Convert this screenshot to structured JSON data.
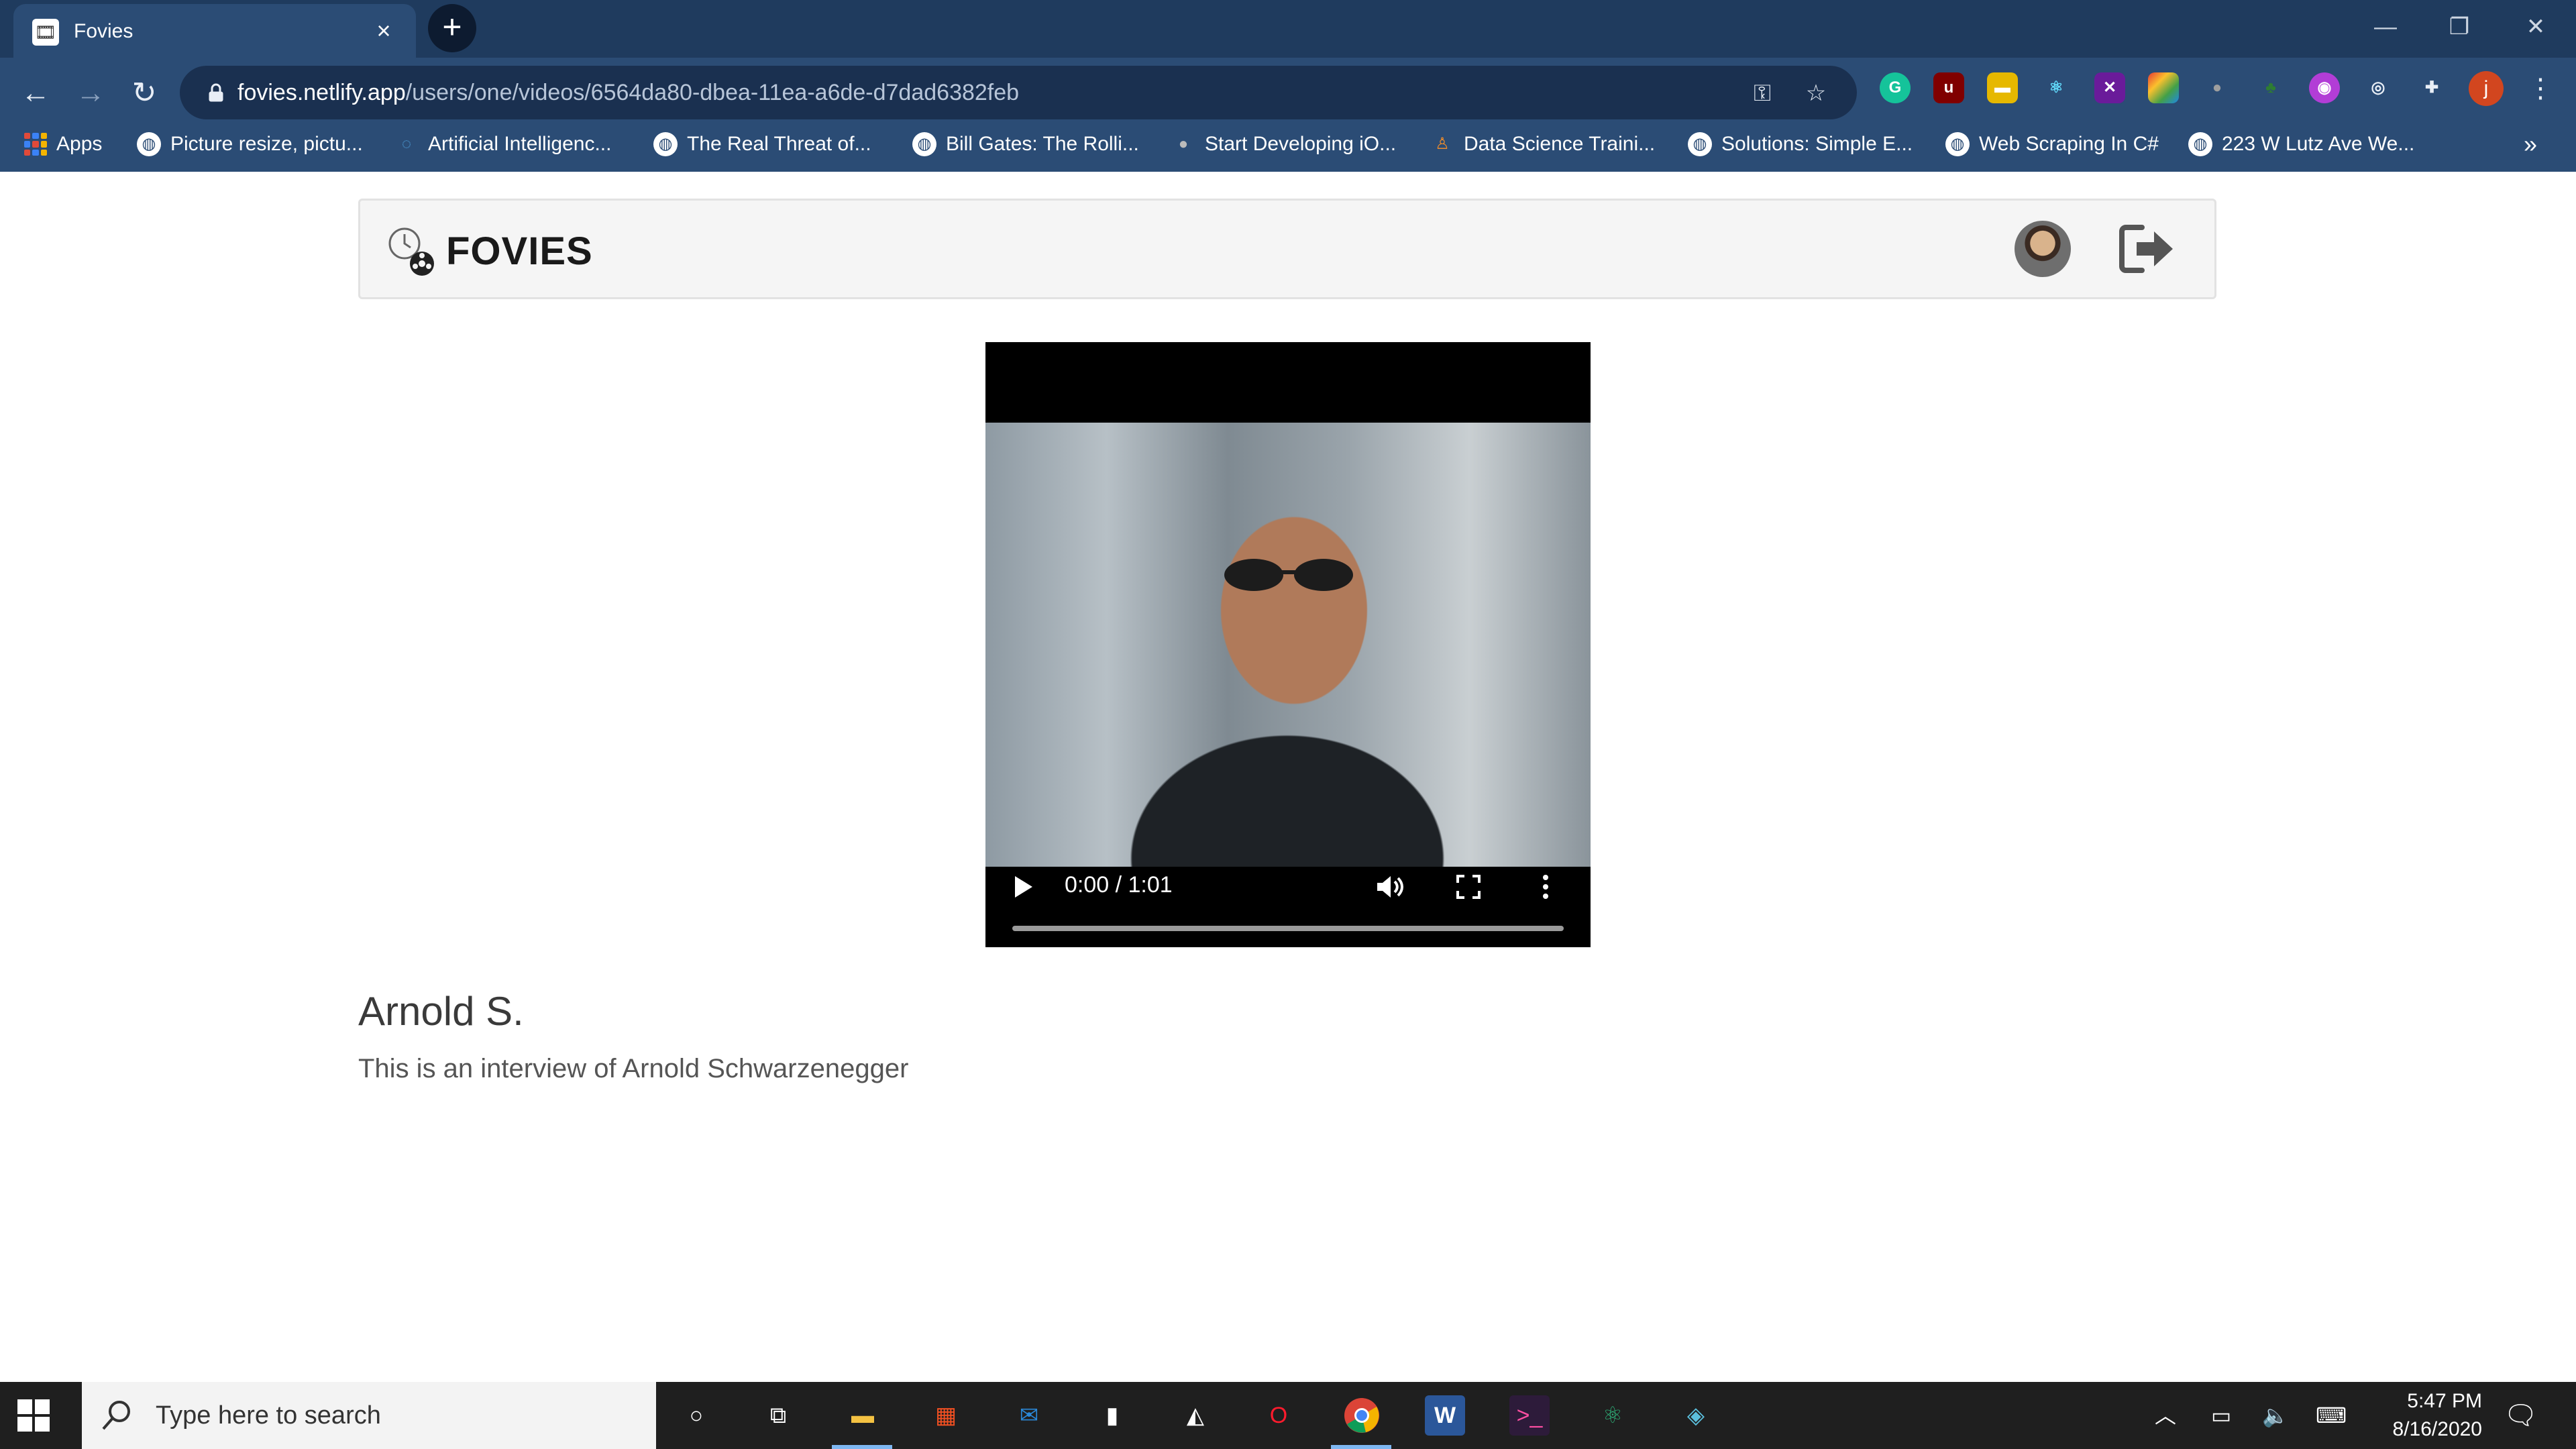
{
  "browser": {
    "tab_title": "Fovies",
    "url_host": "fovies.netlify.app",
    "url_path": "/users/one/videos/6564da80-dbea-11ea-a6de-d7dad6382feb",
    "profile_initial": "j",
    "bookmarks": [
      {
        "label": "Apps",
        "icon": "apps-grid-icon"
      },
      {
        "label": "Picture resize, pictu...",
        "icon": "globe-icon"
      },
      {
        "label": "Artificial Intelligenc...",
        "icon": "intel-icon"
      },
      {
        "label": "The Real Threat of...",
        "icon": "globe-icon"
      },
      {
        "label": "Bill Gates: The Rolli...",
        "icon": "globe-icon"
      },
      {
        "label": "Start Developing iO...",
        "icon": "apple-icon"
      },
      {
        "label": "Data Science Traini...",
        "icon": "person-icon"
      },
      {
        "label": "Solutions: Simple E...",
        "icon": "globe-icon"
      },
      {
        "label": "Web Scraping In C#",
        "icon": "globe-icon"
      },
      {
        "label": "223 W Lutz Ave We...",
        "icon": "globe-icon"
      }
    ]
  },
  "site": {
    "logo_text": "FOVIES"
  },
  "video": {
    "time_display": "0:00 / 1:01",
    "progress_fraction": 0
  },
  "content": {
    "title": "Arnold S.",
    "description": "This is an interview of Arnold Schwarzenegger"
  },
  "taskbar": {
    "search_placeholder": "Type here to search",
    "time": "5:47 PM",
    "date": "8/16/2020"
  },
  "colors": {
    "chrome_dark": "#1f3b5e",
    "chrome_toolbar": "#2b4c75",
    "taskbar": "#1f1f1f"
  }
}
